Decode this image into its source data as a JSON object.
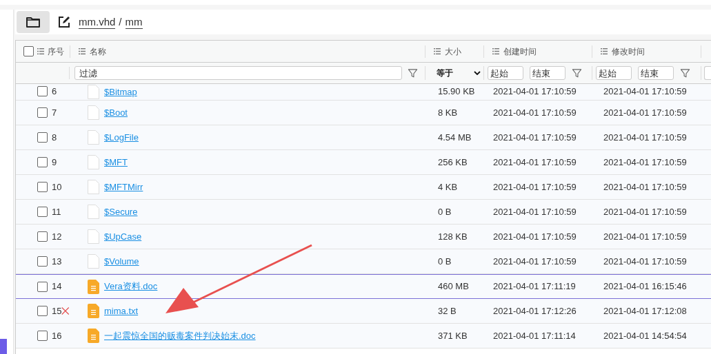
{
  "path": [
    {
      "label": "mm.vhd"
    },
    {
      "label": "mm"
    }
  ],
  "path_separator": "/",
  "select_all": {
    "checked": false
  },
  "columns": [
    {
      "label": "序号"
    },
    {
      "label": "名称"
    },
    {
      "label": "大小"
    },
    {
      "label": "创建时间"
    },
    {
      "label": "修改时间"
    }
  ],
  "filters": {
    "name": {
      "placeholder": "过滤"
    },
    "size": {
      "value": "等于"
    },
    "created": {
      "start_placeholder": "起始",
      "end_placeholder": "结束"
    },
    "modified": {
      "start_placeholder": "起始",
      "end_placeholder": "结束"
    }
  },
  "rows": [
    {
      "index": "6",
      "name": "$Bitmap",
      "kind": "system",
      "size": "15.90 KB",
      "created": "2021-04-01 17:10:59",
      "modified": "2021-04-01 17:10:59",
      "selected": false,
      "deleted": false
    },
    {
      "index": "7",
      "name": "$Boot",
      "kind": "system",
      "size": "8 KB",
      "created": "2021-04-01 17:10:59",
      "modified": "2021-04-01 17:10:59",
      "selected": false,
      "deleted": false
    },
    {
      "index": "8",
      "name": "$LogFile",
      "kind": "system",
      "size": "4.54 MB",
      "created": "2021-04-01 17:10:59",
      "modified": "2021-04-01 17:10:59",
      "selected": false,
      "deleted": false
    },
    {
      "index": "9",
      "name": "$MFT",
      "kind": "system",
      "size": "256 KB",
      "created": "2021-04-01 17:10:59",
      "modified": "2021-04-01 17:10:59",
      "selected": false,
      "deleted": false
    },
    {
      "index": "10",
      "name": "$MFTMirr",
      "kind": "system",
      "size": "4 KB",
      "created": "2021-04-01 17:10:59",
      "modified": "2021-04-01 17:10:59",
      "selected": false,
      "deleted": false
    },
    {
      "index": "11",
      "name": "$Secure",
      "kind": "system",
      "size": "0 B",
      "created": "2021-04-01 17:10:59",
      "modified": "2021-04-01 17:10:59",
      "selected": false,
      "deleted": false
    },
    {
      "index": "12",
      "name": "$UpCase",
      "kind": "system",
      "size": "128 KB",
      "created": "2021-04-01 17:10:59",
      "modified": "2021-04-01 17:10:59",
      "selected": false,
      "deleted": false
    },
    {
      "index": "13",
      "name": "$Volume",
      "kind": "system",
      "size": "0 B",
      "created": "2021-04-01 17:10:59",
      "modified": "2021-04-01 17:10:59",
      "selected": false,
      "deleted": false
    },
    {
      "index": "14",
      "name": "Vera资料.doc",
      "kind": "document",
      "size": "460 MB",
      "created": "2021-04-01 17:11:19",
      "modified": "2021-04-01 16:15:46",
      "selected": true,
      "deleted": false
    },
    {
      "index": "15",
      "name": "mima.txt",
      "kind": "document",
      "size": "32 B",
      "created": "2021-04-01 17:12:26",
      "modified": "2021-04-01 17:12:08",
      "selected": false,
      "deleted": true
    },
    {
      "index": "16",
      "name": "一起震惊全国的贩毒案件判决始末.doc",
      "kind": "document",
      "size": "371 KB",
      "created": "2021-04-01 17:11:14",
      "modified": "2021-04-01 14:54:54",
      "selected": false,
      "deleted": false
    }
  ]
}
